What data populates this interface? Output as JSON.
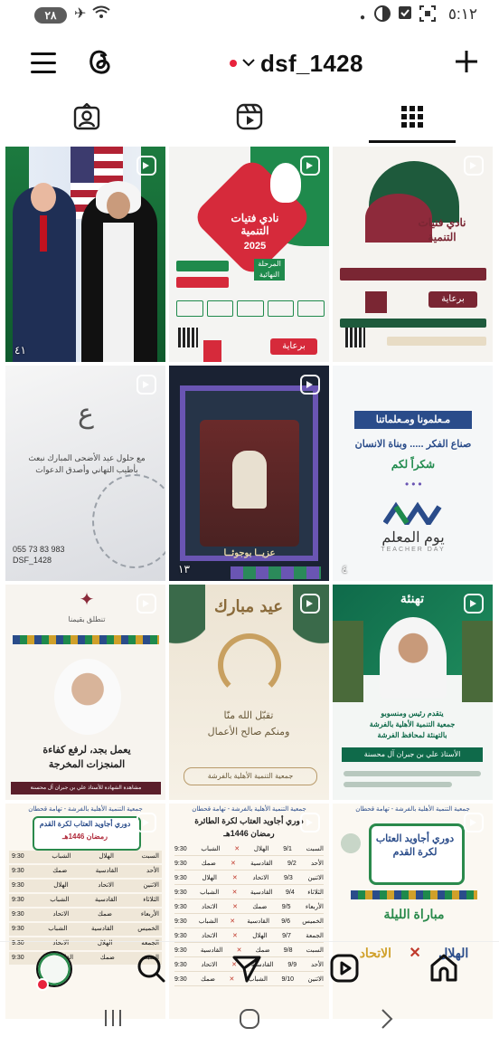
{
  "status": {
    "battery": "٢٨",
    "time": "٥:١٢",
    "airplane": "airplane-icon",
    "wifi": "wifi-icon"
  },
  "header": {
    "username": "dsf_1428"
  },
  "posts": [
    {
      "id": 1,
      "views": "٤١",
      "reel": true
    },
    {
      "id": 2,
      "title": "نادي فتيات التنمية",
      "year": "2025",
      "subtitle": "المرحلة النهائية",
      "button": "برعاية",
      "reel": true
    },
    {
      "id": 3,
      "title": "نادي فتيات التنمية",
      "button": "برعاية",
      "reel": true
    },
    {
      "id": 4,
      "text": "مع حلول عيد الأضحى المبارك نبعث بأطيب التهاني وأصدق الدعوات",
      "phone": "055 73 83 983",
      "handle": "DSF_1428",
      "reel": true
    },
    {
      "id": 5,
      "caption": "عزيــا بوجوئــا",
      "views": "١٣",
      "reel": true
    },
    {
      "id": 6,
      "headline": "مـعلمونا ومـعلماتنا",
      "line1": "صناع الفكر ..... وبناة الانسان",
      "line2": "شكراً لكم",
      "dayAr": "يوم المعلم",
      "dayEn": "TEACHER DAY",
      "views": "٤",
      "reel": false
    },
    {
      "id": 7,
      "tag": "تنطلق بقيمنا",
      "text1": "يعمل بجد، لرفع كفاءة",
      "text2": "المنجزات المخرجة",
      "footer": "مشاهدة الشهادة للأستاذ علي بن جبران آل محسنة",
      "reel": true
    },
    {
      "id": 8,
      "greeting": "عيد مبارك",
      "line1": "تقبّل الله منّا",
      "line2": "ومنكم صالح الأعمال",
      "footer": "جمعية التنمية الأهلية بالفرشة",
      "reel": true
    },
    {
      "id": 9,
      "greeting": "تهنئة",
      "line1": "يتقدم رئيس ومنسوبو",
      "line2": "جمعية التنمية الأهلية بالفرشة",
      "line3": "بالتهنئة لمحافظ الفرشة",
      "name": "الأستاذ علي بن جبران آل محسنة",
      "reel": true
    },
    {
      "id": 10,
      "org": "جمعية التنمية الأهلية بالفرشة - تهامة قحطان",
      "title": "دوري أجاويد العتاب لكرة القدم",
      "subtitle": "رمضان 1446هـ",
      "reel": true
    },
    {
      "id": 11,
      "org": "جمعية التنمية الأهلية بالفرشة - تهامة قحطان",
      "title": "دوري أجاويد العتاب لكرة الطائرة",
      "subtitle": "رمضان 1446هـ",
      "reel": true
    },
    {
      "id": 12,
      "org": "جمعية التنمية الأهلية بالفرشة - تهامة قحطان",
      "title": "دوري أجاويد العتاب لكرة القدم",
      "match": "مباراة الليلة",
      "team1": "الاتحاد",
      "team2": "الهلال",
      "reel": true
    }
  ],
  "schedule": {
    "days": [
      "السبت",
      "الأحد",
      "الاثنين",
      "الثلاثاء",
      "الأربعاء",
      "الخميس",
      "الجمعة",
      "السبت",
      "الأحد",
      "الاثنين"
    ],
    "dates": [
      "9/1",
      "9/2",
      "9/3",
      "9/4",
      "9/5",
      "9/6",
      "9/7",
      "9/8",
      "9/9",
      "9/10"
    ],
    "teamA": [
      "الهلال",
      "القادسية",
      "الاتحاد",
      "القادسية",
      "ضمك",
      "القادسية",
      "الهلال",
      "ضمك",
      "القادسية",
      "الشباب"
    ],
    "teamB": [
      "الشباب",
      "ضمك",
      "الهلال",
      "الشباب",
      "الاتحاد",
      "الشباب",
      "الاتحاد",
      "القادسية",
      "الاتحاد",
      "ضمك"
    ],
    "time": "9:30"
  }
}
